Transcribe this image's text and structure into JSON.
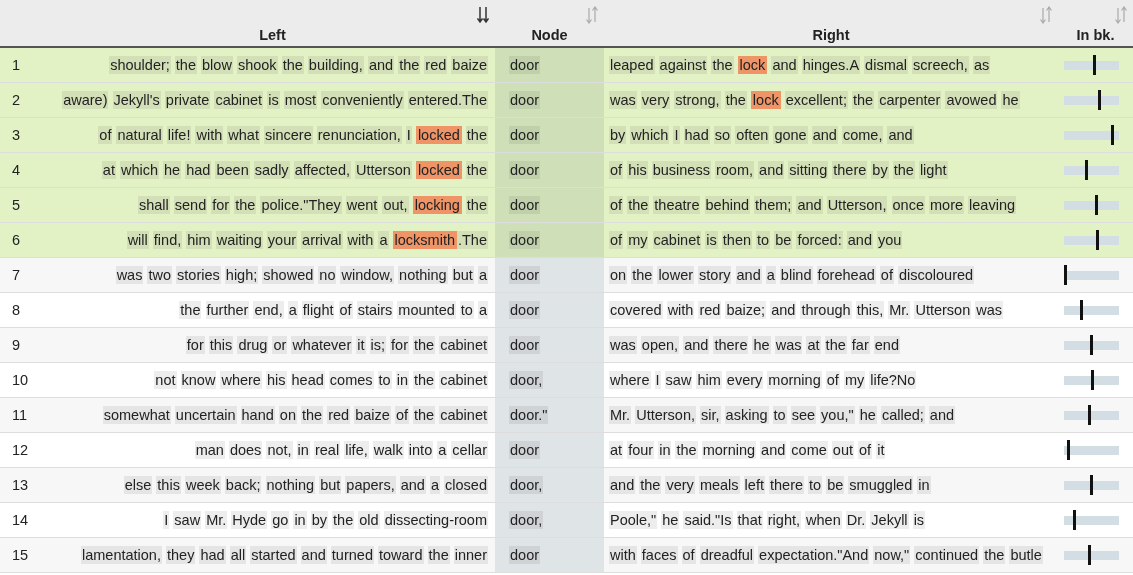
{
  "columns": [
    {
      "label": "Left",
      "sorted": true
    },
    {
      "label": "Node",
      "sorted": false
    },
    {
      "label": "Right",
      "sorted": false
    },
    {
      "label": "In bk.",
      "sorted": false
    }
  ],
  "rows": [
    {
      "number": "1",
      "selected": true,
      "left": [
        {
          "text": "shoulder; the blow shook the building, and the red baize",
          "match": false
        }
      ],
      "node": "door",
      "right": [
        {
          "text": "leaped against the ",
          "match": false
        },
        {
          "text": "lock",
          "match": true
        },
        {
          "text": " and hinges.A dismal screech, as",
          "match": false
        }
      ],
      "level": 0.56
    },
    {
      "number": "2",
      "selected": true,
      "left": [
        {
          "text": "aware) Jekyll's private cabinet is most conveniently entered.The",
          "match": false
        }
      ],
      "node": "door",
      "right": [
        {
          "text": "was very strong, the ",
          "match": false
        },
        {
          "text": "lock",
          "match": true
        },
        {
          "text": " excellent; the carpenter avowed he",
          "match": false
        }
      ],
      "level": 0.65
    },
    {
      "number": "3",
      "selected": true,
      "left": [
        {
          "text": "of natural life! with what sincere renunciation, I ",
          "match": false
        },
        {
          "text": "locked",
          "match": true
        },
        {
          "text": " the",
          "match": false
        }
      ],
      "node": "door",
      "right": [
        {
          "text": "by which I had so often gone and come, and",
          "match": false
        }
      ],
      "level": 0.9
    },
    {
      "number": "4",
      "selected": true,
      "left": [
        {
          "text": "at which he had been sadly affected, Utterson ",
          "match": false
        },
        {
          "text": "locked",
          "match": true
        },
        {
          "text": " the",
          "match": false
        }
      ],
      "node": "door",
      "right": [
        {
          "text": "of his business room, and sitting there by the light",
          "match": false
        }
      ],
      "level": 0.4
    },
    {
      "number": "5",
      "selected": true,
      "left": [
        {
          "text": "shall send for the police.\"They went out, ",
          "match": false
        },
        {
          "text": "locking",
          "match": true
        },
        {
          "text": " the",
          "match": false
        }
      ],
      "node": "door",
      "right": [
        {
          "text": "of the theatre behind them; and Utterson, once more leaving",
          "match": false
        }
      ],
      "level": 0.6
    },
    {
      "number": "6",
      "selected": true,
      "left": [
        {
          "text": "will find, him waiting your arrival with a ",
          "match": false
        },
        {
          "text": "locksmith",
          "match": true
        },
        {
          "text": ".The",
          "match": false
        }
      ],
      "node": "door",
      "right": [
        {
          "text": "of my cabinet is then to be forced: and you",
          "match": false
        }
      ],
      "level": 0.62
    },
    {
      "number": "7",
      "selected": false,
      "left": [
        {
          "text": "was two stories high; showed no window, nothing but a",
          "match": false
        }
      ],
      "node": "door",
      "right": [
        {
          "text": "on the lower story and a blind forehead of discoloured",
          "match": false
        }
      ],
      "level": 0.0
    },
    {
      "number": "8",
      "selected": false,
      "left": [
        {
          "text": "the further end, a flight of stairs mounted to a",
          "match": false
        }
      ],
      "node": "door",
      "right": [
        {
          "text": "covered with red baize; and through this, Mr. Utterson was",
          "match": false
        }
      ],
      "level": 0.3
    },
    {
      "number": "9",
      "selected": false,
      "left": [
        {
          "text": "for this drug or whatever it is; for the cabinet",
          "match": false
        }
      ],
      "node": "door",
      "right": [
        {
          "text": "was open, and there he was at the far end",
          "match": false
        }
      ],
      "level": 0.5
    },
    {
      "number": "10",
      "selected": false,
      "left": [
        {
          "text": "not know where his head comes to in the cabinet",
          "match": false
        }
      ],
      "node": "door,",
      "right": [
        {
          "text": "where I saw him every morning of my life?No",
          "match": false
        }
      ],
      "level": 0.52
    },
    {
      "number": "11",
      "selected": false,
      "left": [
        {
          "text": "somewhat uncertain hand on the red baize of the cabinet",
          "match": false
        }
      ],
      "node": "door.\"",
      "right": [
        {
          "text": "Mr. Utterson, sir, asking to see you,\" he called; and",
          "match": false
        }
      ],
      "level": 0.47
    },
    {
      "number": "12",
      "selected": false,
      "left": [
        {
          "text": "man does not, in real life, walk into a cellar",
          "match": false
        }
      ],
      "node": "door",
      "right": [
        {
          "text": "at four in the morning and come out of it",
          "match": false
        }
      ],
      "level": 0.05
    },
    {
      "number": "13",
      "selected": false,
      "left": [
        {
          "text": "else this week back; nothing but papers, and a closed",
          "match": false
        }
      ],
      "node": "door,",
      "right": [
        {
          "text": "and the very meals left there to be smuggled in",
          "match": false
        }
      ],
      "level": 0.5
    },
    {
      "number": "14",
      "selected": false,
      "left": [
        {
          "text": "I saw Mr. Hyde go in by the old dissecting-room",
          "match": false
        }
      ],
      "node": "door,",
      "right": [
        {
          "text": "Poole,\" he said.\"Is that right, when Dr. Jekyll is",
          "match": false
        }
      ],
      "level": 0.18
    },
    {
      "number": "15",
      "selected": false,
      "left": [
        {
          "text": "lamentation, they had all started and turned toward the inner",
          "match": false
        }
      ],
      "node": "door",
      "right": [
        {
          "text": "with faces of dreadful expectation.\"And now,\" continued the butle",
          "match": false
        }
      ],
      "level": 0.46
    }
  ]
}
